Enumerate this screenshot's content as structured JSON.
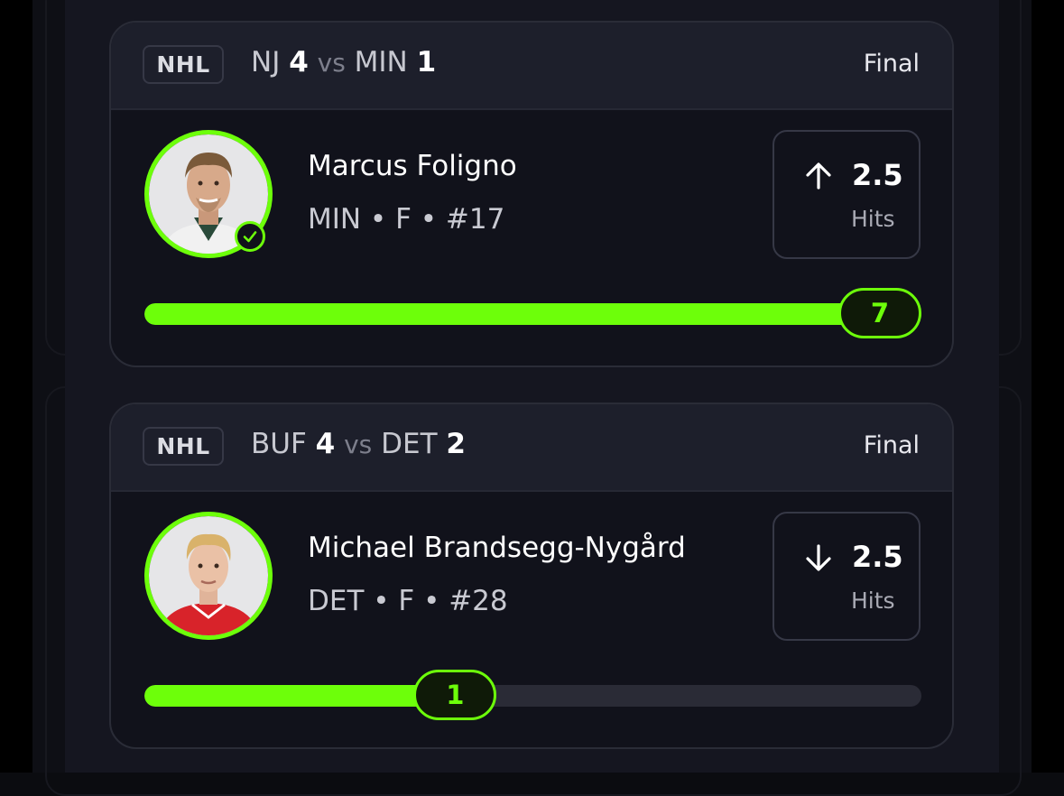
{
  "colors": {
    "accent": "#6dff0a",
    "card_bg": "#11121b",
    "header_bg": "#1d1f2b"
  },
  "cards": [
    {
      "league": "NHL",
      "home_team": "NJ",
      "home_score": "4",
      "vs": "vs",
      "away_team": "MIN",
      "away_score": "1",
      "status": "Final",
      "player": {
        "name": "Marcus Foligno",
        "meta": "MIN • F • #17",
        "verified_icon": "check-circle-icon"
      },
      "line": {
        "direction": "up",
        "arrow_icon": "arrow-up-icon",
        "value": "2.5",
        "stat": "Hits"
      },
      "progress": {
        "result": "7",
        "fill_fraction": 1.0
      }
    },
    {
      "league": "NHL",
      "home_team": "BUF",
      "home_score": "4",
      "vs": "vs",
      "away_team": "DET",
      "away_score": "2",
      "status": "Final",
      "player": {
        "name": "Michael Brandsegg-Nygård",
        "meta": "DET • F • #28"
      },
      "line": {
        "direction": "down",
        "arrow_icon": "arrow-down-icon",
        "value": "2.5",
        "stat": "Hits"
      },
      "progress": {
        "result": "1",
        "fill_fraction": 0.4
      }
    }
  ]
}
